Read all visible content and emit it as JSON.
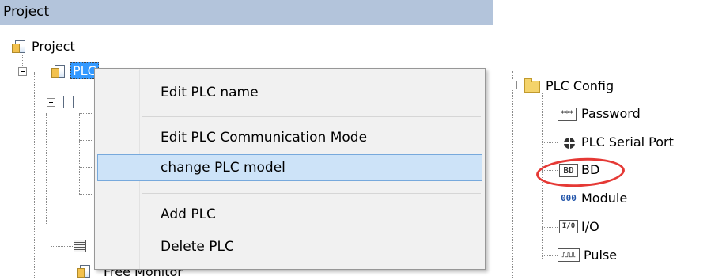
{
  "panel": {
    "title": "Project",
    "tree": {
      "root_label": "Project",
      "plc_label": "PLC",
      "partial_item_label": "Free Monitor"
    }
  },
  "context_menu": {
    "items": [
      {
        "label": "Edit PLC name"
      },
      {
        "label": "Edit PLC Communication Mode"
      },
      {
        "label": "change PLC model",
        "highlighted": true
      },
      {
        "label": "Add PLC"
      },
      {
        "label": "Delete PLC"
      }
    ]
  },
  "plc_config": {
    "folder_label": "PLC Config",
    "children": [
      {
        "label": "Password",
        "icon": "password-icon",
        "glyph": "***"
      },
      {
        "label": "PLC Serial Port",
        "icon": "serial-port-icon"
      },
      {
        "label": "BD",
        "icon": "bd-icon",
        "glyph": "BD"
      },
      {
        "label": "Module",
        "icon": "module-icon",
        "glyph": "000"
      },
      {
        "label": "I/O",
        "icon": "io-icon",
        "glyph": "I/0"
      },
      {
        "label": "Pulse",
        "icon": "pulse-icon",
        "glyph": "⎍⎍⎍"
      }
    ]
  },
  "colors": {
    "header_bg": "#b3c4db",
    "selection_bg": "#3399ff",
    "menu_highlight": "#cde3f8",
    "annotation_circle": "#e53935"
  }
}
